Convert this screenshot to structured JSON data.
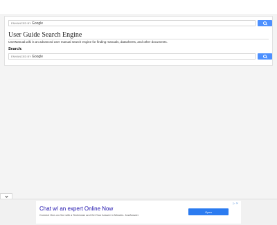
{
  "page": {
    "title": "User Guide Search Engine",
    "description": "UserManual.wiki is an advanced user manual search engine for finding manuals, datasheets, and other documents.",
    "search_label": "Search:"
  },
  "search_boxes": {
    "top": {
      "enhanced": "ENHANCED BY",
      "brand": "Google"
    },
    "bottom": {
      "enhanced": "ENHANCED BY",
      "brand": "Google"
    }
  },
  "ad": {
    "title": "Chat w/ an expert Online Now",
    "subtitle": "Connect One-on-One with a Technician and Get Your Answer in Minutes. JustAnswer",
    "button": "Open",
    "adchoices": "▷ ✕"
  },
  "colors": {
    "search_button": "#4d90fe",
    "ad_button": "#2b7bf0",
    "ad_title": "#1a0dab"
  }
}
